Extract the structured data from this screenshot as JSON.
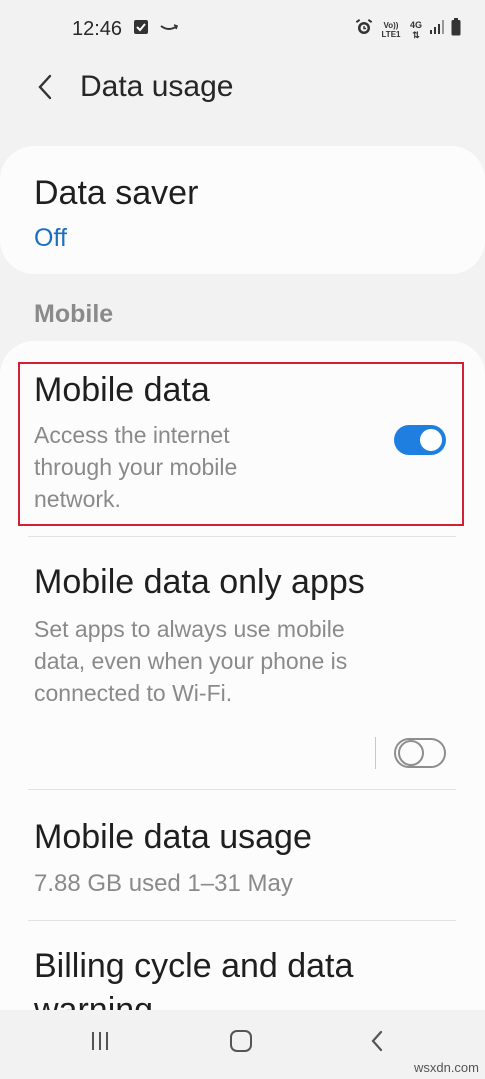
{
  "status_bar": {
    "time": "12:46",
    "left_icons": [
      "gallery-notification-icon",
      "amazon-icon"
    ],
    "right_icons": [
      "alarm-icon",
      "volte-icon",
      "4g-data-icon",
      "signal-icon",
      "battery-icon"
    ],
    "volte_label": "Vo)) LTE1",
    "network_label": "4G"
  },
  "app_bar": {
    "title": "Data usage"
  },
  "data_saver": {
    "title": "Data saver",
    "value": "Off"
  },
  "section_mobile": {
    "header": "Mobile"
  },
  "mobile_data": {
    "title": "Mobile data",
    "subtitle_lines": [
      "Access the internet",
      "through your mobile",
      "network."
    ],
    "toggle_on": true
  },
  "mobile_data_only_apps": {
    "title": "Mobile data only apps",
    "subtitle_lines": [
      "Set apps to always use mobile",
      "data, even when your phone is",
      "connected to Wi‑Fi."
    ],
    "toggle_on": false
  },
  "mobile_data_usage": {
    "title": "Mobile data usage",
    "subtitle": "7.88 GB used 1–31 May"
  },
  "billing_cycle": {
    "title_lines": [
      "Billing cycle and data",
      "warning"
    ]
  },
  "nav_bar": {
    "buttons": [
      "recents-icon",
      "home-icon",
      "back-icon"
    ]
  },
  "watermark": "wsxdn.com",
  "colors": {
    "accent": "#1f7fe0",
    "link_blue": "#1a6fc4",
    "highlight_red": "#d61f34",
    "background": "#f2f2f2",
    "card": "#fcfcfc"
  }
}
